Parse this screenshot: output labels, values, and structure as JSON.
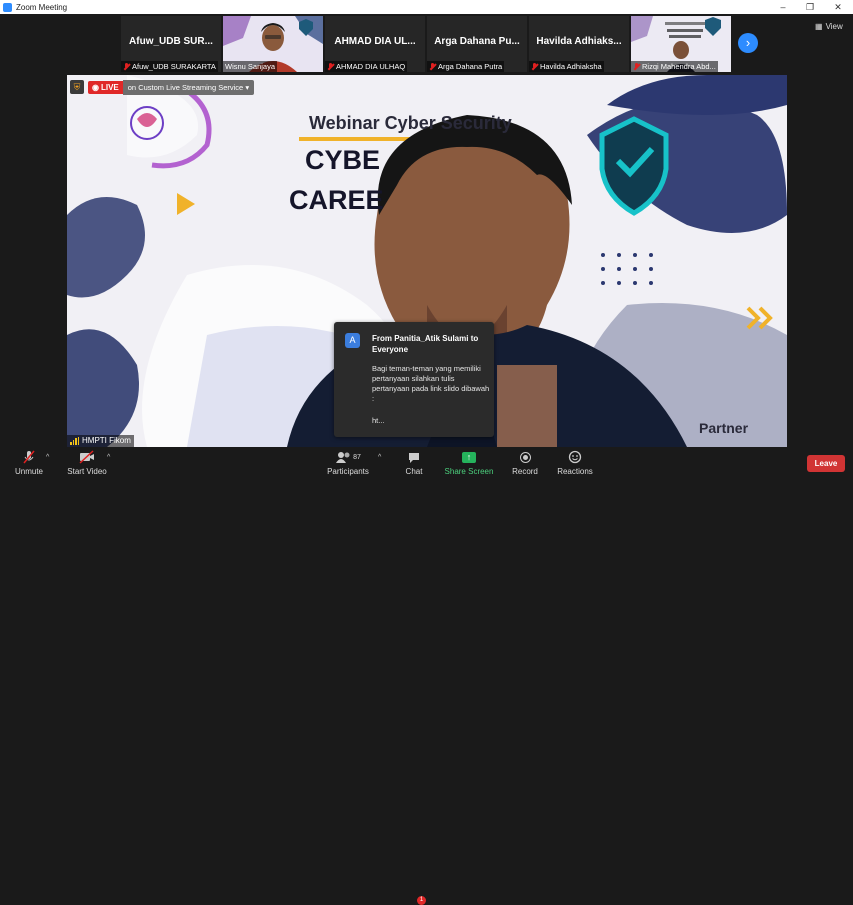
{
  "window": {
    "title": "Zoom Meeting",
    "controls": [
      "–",
      "❐",
      "✕"
    ]
  },
  "participants_strip": [
    {
      "display_name": "Afuw_UDB SUR...",
      "label": "Afuw_UDB SURAKARTA",
      "muted": true,
      "has_video": false
    },
    {
      "display_name": "",
      "label": "Wisnu Sanjaya",
      "muted": false,
      "has_video": true
    },
    {
      "display_name": "AHMAD DIA UL...",
      "label": "AHMAD DIA ULHAQ",
      "muted": true,
      "has_video": false
    },
    {
      "display_name": "Arga Dahana Pu...",
      "label": "Arga Dahana Putra",
      "muted": true,
      "has_video": false
    },
    {
      "display_name": "Havilda Adhiaks...",
      "label": "Havilda Adhiaksha",
      "muted": true,
      "has_video": false
    },
    {
      "display_name": "",
      "label": "Rizqi Mahendra Abd...",
      "muted": true,
      "has_video": true
    }
  ],
  "next_page_icon": "chevron-right-icon",
  "view_button": {
    "label": "View",
    "icon": "grid-icon"
  },
  "live_banner": {
    "badge": "LIVE",
    "description": "on Custom Live Streaming Service"
  },
  "slide": {
    "heading": "Webinar Cyber Security",
    "title_line1": "CYBE",
    "title_line2": "CAREE",
    "partner": "Partner"
  },
  "speaker_label": "HMPTI Fikom",
  "chat_popup": {
    "avatar_letter": "A",
    "from": "From Panitia_Atik Sulami to Everyone",
    "message": "Bagi teman-teman yang memiliki pertanyaan silahkan tulis pertanyaan pada link slido dibawah :",
    "truncated": "ht..."
  },
  "toolbar": {
    "unmute": "Unmute",
    "start_video": "Start Video",
    "participants": "Participants",
    "participants_count": "87",
    "chat": "Chat",
    "chat_badge": "1",
    "share_screen": "Share Screen",
    "record": "Record",
    "reactions": "Reactions",
    "leave": "Leave"
  },
  "colors": {
    "accent": "#2d8cff",
    "live_red": "#e02828",
    "share_green": "#25b35c",
    "leave_red": "#d13434"
  }
}
